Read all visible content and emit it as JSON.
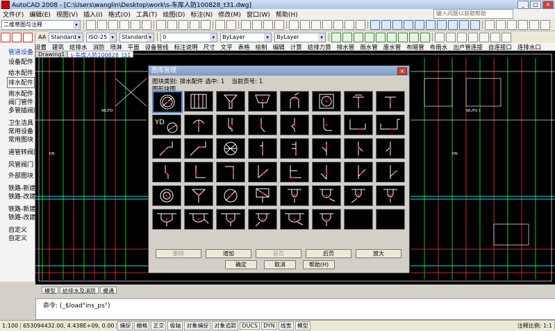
{
  "window": {
    "title": "AutoCAD 2008 - [C:\\Users\\wanglin\\Desktop\\work\\s-车库人防100828_t31.dwg]",
    "minimize": "_",
    "maximize": "□",
    "close": "×"
  },
  "menu": [
    "文件(F)",
    "编辑(E)",
    "视图(V)",
    "插入(I)",
    "格式(O)",
    "工具(T)",
    "绘图(D)",
    "标注(N)",
    "修改(M)",
    "窗口(W)",
    "帮助(H)"
  ],
  "help_placeholder": "键入问题以获取帮助",
  "toolbar": {
    "workspace": "二维草图与注释",
    "layer_combo": "0",
    "color_combo": "ByLayer",
    "linetype_combo": "ByLayer",
    "text_style": "Standard",
    "dim_style": "ISO-25",
    "table_style": "Standard"
  },
  "top_tabs": [
    "设置",
    "建筑",
    "给排水",
    "消防",
    "喷淋",
    "平面",
    "设备管线",
    "标注说明",
    "尺寸",
    "文字",
    "表格",
    "绘制",
    "编辑",
    "计算",
    "给排力算",
    "排水管",
    "雨水管",
    "废水管",
    "布暗管",
    "布雨水",
    "出户管连接",
    "自连接口",
    "连排水口"
  ],
  "drawing_tabs": [
    {
      "label": "Drawing1",
      "active": false
    },
    {
      "label": "s-车库人防100828_t31",
      "active": true
    }
  ],
  "side_panel": {
    "header": "管道设备",
    "items": [
      "设备配件",
      "给水配件",
      "排水配件",
      "雨水配件",
      "阀门管件",
      "多管插阀门",
      "卫生洁具",
      "常用设备",
      "常用图块",
      "道管转阀门",
      "风管阀门",
      "外部图块",
      "铁路-新建",
      "铁路-改建",
      "铁路-新建",
      "铁路-改建",
      "自定义",
      "自定义"
    ],
    "selected": "排水配件"
  },
  "dialog": {
    "title": "图库管理",
    "close": "×",
    "category_label": "图块类别:",
    "category_value": "排水配件",
    "selected_label": "选中:",
    "selected_value": "1",
    "page_label": "当前页号:",
    "page_value": "1",
    "subcategory": "图形块图",
    "buttons": {
      "delete": "删除",
      "add": "增加",
      "prev": "前页",
      "next": "后页",
      "zoom": "放大",
      "ok": "确定",
      "cancel": "取消",
      "help": "帮助(H)"
    },
    "icons": [
      "floor-drain-icon",
      "grill-drain-icon",
      "funnel-drain-icon",
      "cup-drain-icon",
      "siphon-pipe-icon",
      "square-drain-icon",
      "t-vent-icon",
      "t-vent-icon-2",
      "yd-drain-icon",
      "hook-drain-icon",
      "s-trap-icon",
      "s-trap-icon-2",
      "s-trap-icon-3",
      "pipe-bend-icon",
      "u-trap-icon",
      "u-trap-icon-2",
      "pipe-elbow-icon",
      "pipe-elbow-icon-2",
      "mesh-drain-icon",
      "vertical-pipe-icon",
      "vertical-pipe-icon-2",
      "vertical-pipe-icon-3",
      "vertical-pipe-icon-4",
      "vertical-pipe-icon-5",
      "s-pipe-icon",
      "l-pipe-icon",
      "l-pipe-icon-2",
      "diagonal-pipe-icon",
      "l-pipe-icon-3",
      "diagonal-pipe-icon-2",
      "diagonal-pipe-icon-3",
      "diagonal-pipe-icon-4",
      "circle-drain-icon",
      "y-drain-icon",
      "slash-drain-icon",
      "box-drain-icon",
      "p-trap-icon",
      "p-trap-icon-2",
      "p-trap-icon-3",
      "p-trap-icon-4",
      "p-trap-icon-5",
      "p-trap-icon-6",
      "p-trap-icon-7",
      "p-trap-icon-8",
      "p-trap-icon-9",
      "p-trap-icon-10",
      "empty-slot",
      "empty-slot"
    ]
  },
  "layout_tabs": [
    "模型",
    "给排水及消防",
    "暖通"
  ],
  "command": {
    "line1": "命令: (_$load\"ins_ps\")"
  },
  "statusbar": {
    "scale": "1:100",
    "coords": "653094432.00, 4.438E+09, 0.00",
    "modes": [
      "捕捉",
      "栅格",
      "正交",
      "极轴",
      "对象捕捉",
      "对象追踪",
      "DUCS",
      "DYN",
      "线宽",
      "模型"
    ],
    "annotation_scale": "注释比例: 1:1"
  },
  "colors": {
    "canvas_bg": "#000000",
    "cad_green": "#00ff00",
    "cad_red": "#ff0000",
    "cad_cyan": "#00ffff",
    "dialog_face": "#d4d0c8",
    "selection": "#4a8ae0"
  }
}
